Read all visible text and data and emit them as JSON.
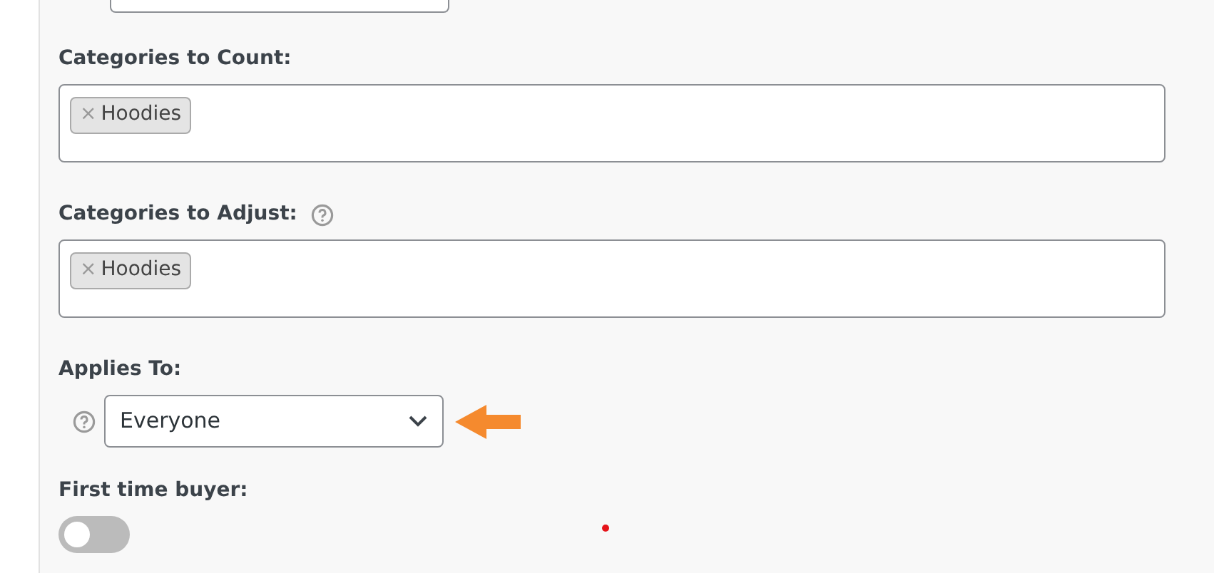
{
  "fields": [
    {
      "kind": "tags",
      "label": "Categories to Count:",
      "help": false,
      "tags": [
        "Hoodies"
      ],
      "remove_glyph": "×"
    },
    {
      "kind": "tags",
      "label": "Categories to Adjust:",
      "help": true,
      "tags": [
        "Hoodies"
      ],
      "remove_glyph": "×"
    },
    {
      "kind": "select",
      "label": "Applies To:",
      "help": true,
      "value": "Everyone",
      "pointer_arrow": true
    },
    {
      "kind": "toggle",
      "label": "First time buyer:",
      "on": false
    }
  ]
}
